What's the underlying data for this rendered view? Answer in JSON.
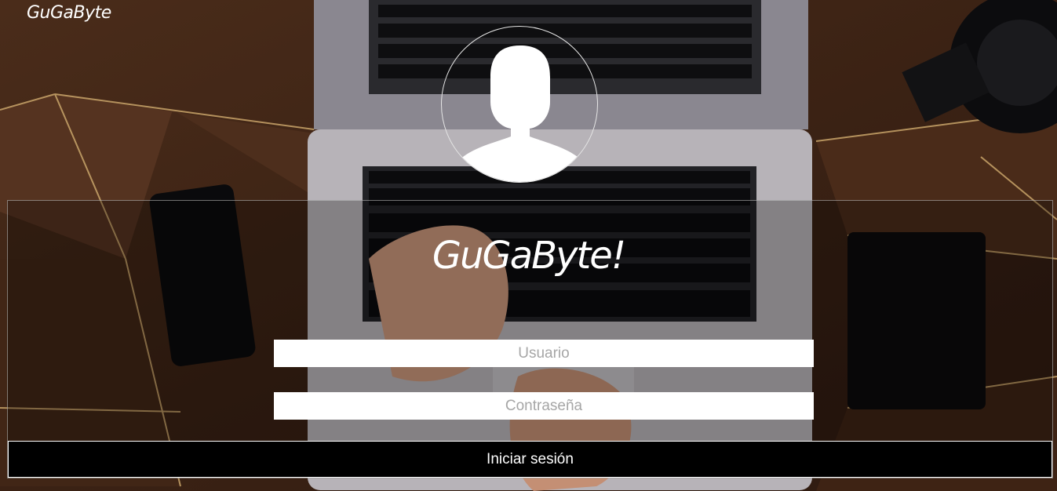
{
  "header": {
    "brand": "GuGaByte"
  },
  "avatar": {
    "icon": "user-silhouette-icon"
  },
  "login": {
    "title": "GuGaByte!",
    "username_placeholder": "Usuario",
    "username_value": "",
    "password_placeholder": "Contraseña",
    "password_value": "",
    "submit_label": "Iniciar sesión"
  },
  "colors": {
    "button_bg": "#000000",
    "input_bg": "#ffffff",
    "text": "#ffffff",
    "placeholder": "#a6a6a6"
  }
}
